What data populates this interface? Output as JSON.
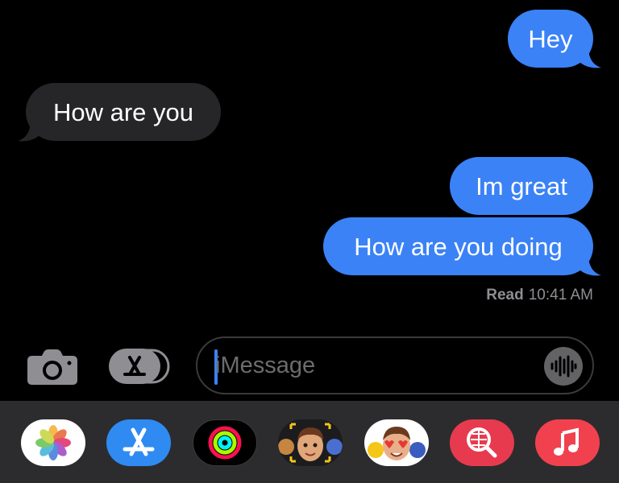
{
  "messages": [
    {
      "text": "Hey",
      "direction": "sent"
    },
    {
      "text": "How are you",
      "direction": "received"
    },
    {
      "text": "Im great",
      "direction": "sent"
    },
    {
      "text": "How are you doing",
      "direction": "sent"
    }
  ],
  "read_receipt": {
    "label": "Read",
    "time": "10:41 AM"
  },
  "composer": {
    "placeholder": "iMessage",
    "camera_icon": "camera-icon",
    "apps_icon": "app-store-icon",
    "audio_icon": "waveform-icon"
  },
  "app_drawer": [
    {
      "name": "Photos",
      "icon": "photos-icon"
    },
    {
      "name": "App Store",
      "icon": "app-store-icon"
    },
    {
      "name": "Activity",
      "icon": "activity-rings-icon"
    },
    {
      "name": "Memoji",
      "icon": "memoji-icon"
    },
    {
      "name": "Memoji Stickers",
      "icon": "memoji-stickers-icon"
    },
    {
      "name": "Images Search",
      "icon": "globe-search-icon"
    },
    {
      "name": "Music",
      "icon": "music-note-icon"
    }
  ],
  "colors": {
    "sent_bubble": "#3b82f6",
    "received_bubble": "#262628",
    "background": "#000000",
    "drawer": "#2c2c2e"
  }
}
